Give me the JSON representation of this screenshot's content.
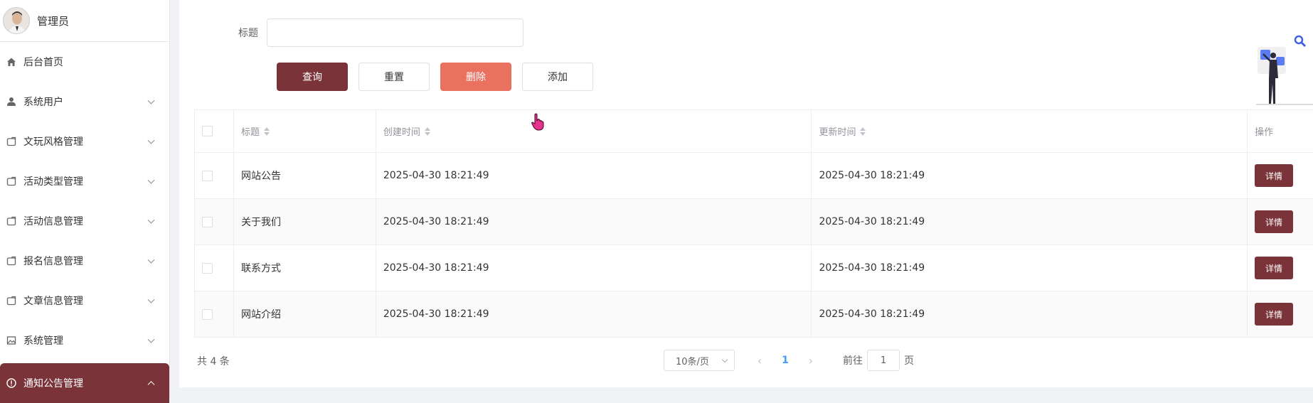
{
  "sidebar": {
    "user_name": "管理员",
    "items": [
      {
        "label": "后台首页",
        "icon": "home-icon",
        "expandable": false
      },
      {
        "label": "系统用户",
        "icon": "user-icon",
        "expandable": true
      },
      {
        "label": "文玩风格管理",
        "icon": "folder-icon",
        "expandable": true
      },
      {
        "label": "活动类型管理",
        "icon": "folder-icon",
        "expandable": true
      },
      {
        "label": "活动信息管理",
        "icon": "folder-icon",
        "expandable": true
      },
      {
        "label": "报名信息管理",
        "icon": "folder-icon",
        "expandable": true
      },
      {
        "label": "文章信息管理",
        "icon": "folder-icon",
        "expandable": true
      },
      {
        "label": "系统管理",
        "icon": "image-icon",
        "expandable": true
      },
      {
        "label": "通知公告管理",
        "icon": "alert-circle-icon",
        "expandable": true,
        "active": true
      }
    ]
  },
  "search": {
    "title_label": "标题",
    "title_value": "",
    "query_label": "查询",
    "reset_label": "重置",
    "delete_label": "删除",
    "add_label": "添加"
  },
  "table": {
    "columns": [
      "标题",
      "创建时间",
      "更新时间",
      "操作"
    ],
    "rows": [
      {
        "title": "网站公告",
        "created": "2025-04-30 18:21:49",
        "updated": "2025-04-30 18:21:49",
        "action": "详情"
      },
      {
        "title": "关于我们",
        "created": "2025-04-30 18:21:49",
        "updated": "2025-04-30 18:21:49",
        "action": "详情"
      },
      {
        "title": "联系方式",
        "created": "2025-04-30 18:21:49",
        "updated": "2025-04-30 18:21:49",
        "action": "详情"
      },
      {
        "title": "网站介绍",
        "created": "2025-04-30 18:21:49",
        "updated": "2025-04-30 18:21:49",
        "action": "详情"
      }
    ]
  },
  "pagination": {
    "total_text": "共 4 条",
    "page_size": "10条/页",
    "prev": "‹",
    "next": "›",
    "current_page": "1",
    "goto_prefix": "前往",
    "goto_value": "1",
    "goto_suffix": "页"
  },
  "colors": {
    "primary": "#7a3338",
    "danger": "#ea7160",
    "link": "#409eff"
  }
}
